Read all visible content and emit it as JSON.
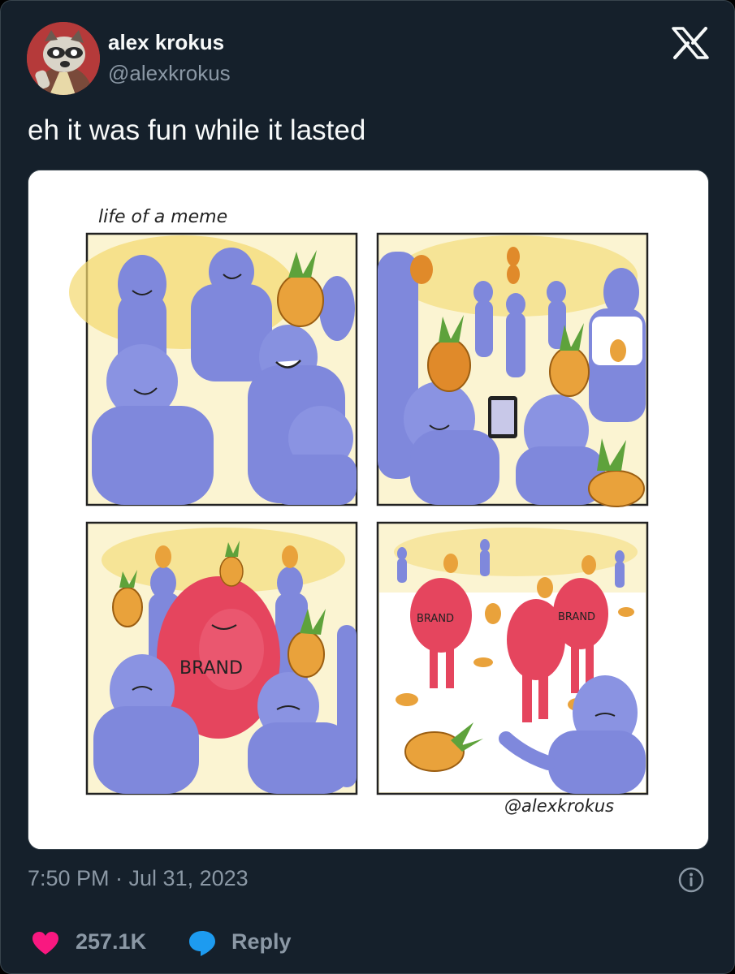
{
  "author": {
    "display_name": "alex krokus",
    "handle": "@alexkrokus",
    "avatar_icon": "raccoon-avatar-icon"
  },
  "platform_icon": "x-logo-icon",
  "tweet": {
    "text": "eh it was fun while it lasted",
    "timestamp": "7:50 PM · Jul 31, 2023"
  },
  "comic": {
    "title": "life of a meme",
    "brand_labels": [
      "BRAND",
      "BRAND",
      "BRAND"
    ],
    "signature": "@alexkrokus"
  },
  "actions": {
    "like_count": "257.1K",
    "reply_label": "Reply",
    "info_icon": "info-icon",
    "heart_icon": "heart-icon",
    "reply_icon": "speech-bubble-icon"
  },
  "colors": {
    "background": "#15202b",
    "text_primary": "#f7f9f9",
    "text_secondary": "#8b98a5",
    "heart": "#f91880",
    "reply": "#1d9bf0",
    "figure_blue": "#7f88dc",
    "brand_red": "#e5455e",
    "pineapple": "#e9a23b"
  }
}
